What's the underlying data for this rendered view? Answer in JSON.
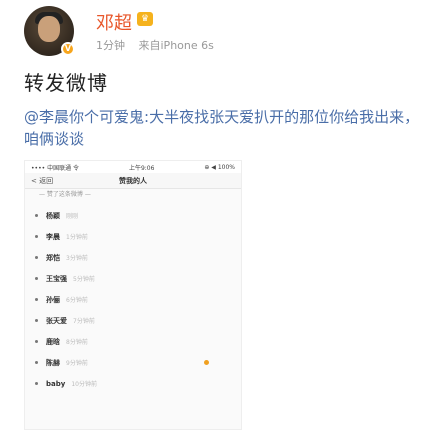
{
  "post": {
    "author": "邓超",
    "time": "1分钟",
    "source": "来自iPhone 6s",
    "title": "转发微博",
    "mention": "@李晨",
    "text": "你个可爱鬼:大半夜找张天爱扒开的那位你给我出来，咱俩谈谈"
  },
  "embed": {
    "status_left": "•••• 中国联通 令",
    "status_center": "上午9:06",
    "status_right": "⊕ ◀ 100%",
    "back_label": "< 返回",
    "nav_title": "赞我的人",
    "subtitle": "— 赞了这条微博 —",
    "items": [
      {
        "name": "杨颖",
        "time": "刚刚"
      },
      {
        "name": "李晨",
        "time": "1分钟前"
      },
      {
        "name": "郑恺",
        "time": "3分钟前"
      },
      {
        "name": "王宝强",
        "time": "5分钟前"
      },
      {
        "name": "孙俪",
        "time": "6分钟前"
      },
      {
        "name": "张天爱",
        "time": "7分钟前"
      },
      {
        "name": "鹿晗",
        "time": "8分钟前"
      },
      {
        "name": "陈赫",
        "time": "9分钟前"
      },
      {
        "name": "baby",
        "time": "10分钟前"
      }
    ]
  },
  "colors": {
    "username": "#e8562a",
    "mention": "#4a6ea8",
    "vip": "#f5b21d"
  }
}
